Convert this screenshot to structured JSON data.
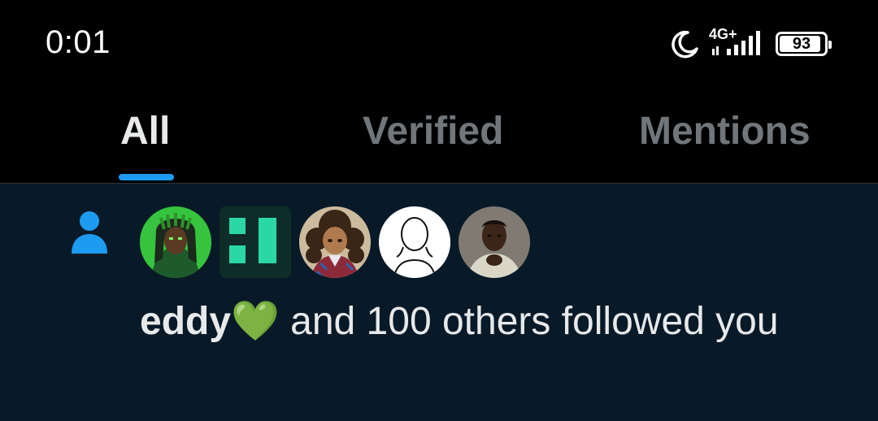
{
  "status_bar": {
    "time": "0:01",
    "network": "4G+",
    "battery_percent": 93,
    "battery_label": "93",
    "icons": [
      "moon-icon",
      "signal-icon",
      "battery-icon"
    ]
  },
  "tabs": [
    {
      "label": "All",
      "active": true
    },
    {
      "label": "Verified",
      "active": false
    },
    {
      "label": "Mentions",
      "active": false
    }
  ],
  "notification": {
    "icon": "person-icon",
    "avatars": [
      {
        "name": "avatar-green-dreadlocks"
      },
      {
        "name": "avatar-green-logo"
      },
      {
        "name": "avatar-curly-hair-girl"
      },
      {
        "name": "avatar-blank-sketch"
      },
      {
        "name": "avatar-photo-man"
      }
    ],
    "name": "eddy💚",
    "text": " and 100 others followed you"
  },
  "colors": {
    "accent": "#1d9bf0",
    "background": "#000000",
    "feed_background": "#081a28",
    "text": "#e7e9ea",
    "muted": "#71767b"
  }
}
